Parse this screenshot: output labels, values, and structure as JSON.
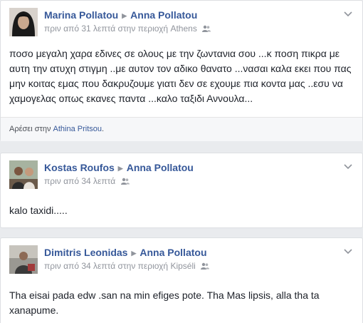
{
  "posts": [
    {
      "author": "Marina Pollatou",
      "target": "Anna Pollatou",
      "time": "πριν από 31 λεπτά",
      "location_prefix": "στην περιοχή",
      "location": "Athens",
      "text": "ποσο μεγαλη χαρα εδινες σε ολους με την ζωντανια σου ...κ ποση πικρα με αυτη την ατυχη στιγμη ..με αυτον τον αδικο θανατο ...νασαι καλα εκει που πας μην κοιτας εμας που δακρυζουμε γιατι δεν σε εχουμε πια κοντα μας ..εσυ να χαμογελας οπως εκανες παντα ...καλο ταξιδι Αννουλα...",
      "likes_prefix": "Αρέσει στην",
      "likes_name": "Athina Pritsou",
      "likes_suffix": "."
    },
    {
      "author": "Kostas Roufos",
      "target": "Anna Pollatou",
      "time": "πριν από 34 λεπτά",
      "text": "kalo taxidi....."
    },
    {
      "author": "Dimitris Leonidas",
      "target": "Anna Pollatou",
      "time": "πριν από 34 λεπτά",
      "location_prefix": "στην περιοχή",
      "location": "Kipséli",
      "text": "Tha eisai pada edw .san na min efiges pote. Tha Mas lipsis, alla tha ta xanapume."
    }
  ],
  "icons": {
    "arrow": "right-triangle-icon",
    "audience": "friends-icon",
    "menu": "chevron-down-icon"
  },
  "colors": {
    "link": "#365899",
    "meta": "#90949c",
    "background": "#e9ebee"
  }
}
